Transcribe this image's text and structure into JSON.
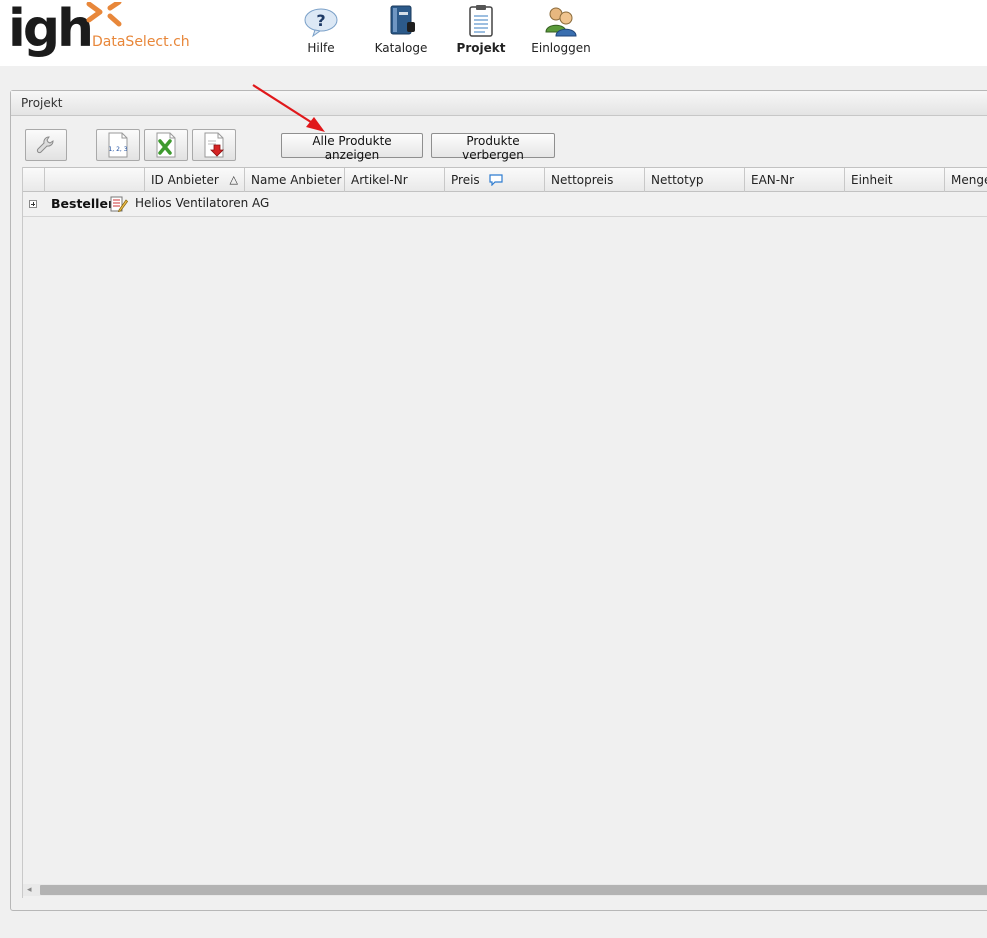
{
  "logo": {
    "brand": "igh",
    "subtitle": "DataSelect.ch"
  },
  "nav": {
    "items": [
      {
        "label": "Hilfe",
        "icon": "help-icon",
        "active": false
      },
      {
        "label": "Kataloge",
        "icon": "catalog-book-icon",
        "active": false
      },
      {
        "label": "Projekt",
        "icon": "clipboard-icon",
        "active": true
      },
      {
        "label": "Einloggen",
        "icon": "users-icon",
        "active": false
      }
    ]
  },
  "panel": {
    "title": "Projekt"
  },
  "toolbar": {
    "numbering_icon_text": "1, 2, 3",
    "show_all_label": "Alle Produkte anzeigen",
    "hide_label": "Produkte verbergen"
  },
  "grid": {
    "columns": [
      "ID Anbieter",
      "Name Anbieter",
      "Artikel-Nr",
      "Preis",
      "Nettopreis",
      "Nettotyp",
      "EAN-Nr",
      "Einheit",
      "Menge"
    ],
    "sort_indicator": "△",
    "group": {
      "title": "Bestellen",
      "supplier": "Helios Ventilatoren AG"
    },
    "scroll_left_glyph": "◂"
  },
  "colors": {
    "accent_orange": "#e8873a",
    "arrow_red": "#e0181b"
  }
}
